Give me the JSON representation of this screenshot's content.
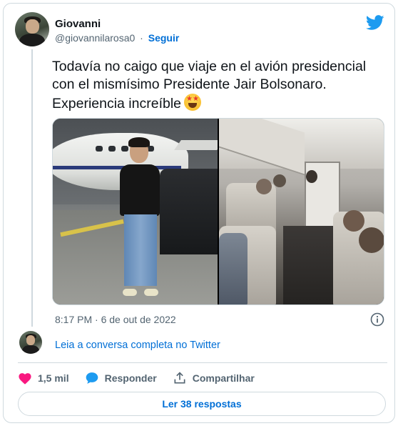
{
  "author": {
    "name": "Giovanni",
    "handle": "@giovannilarosa0",
    "separator": "·",
    "follow_label": "Seguir",
    "avatar_icon": "user-avatar"
  },
  "tweet": {
    "text": "Todavía no caigo que viaje en el avión presidencial con el mismísimo Presidente Jair Bolsonaro. Experiencia increíble",
    "emoji": "star-struck-emoji",
    "timestamp": "8:17 PM · 6 de out de 2022"
  },
  "conversation_link": "Leia a conversa completa no Twitter",
  "actions": {
    "like_count": "1,5 mil",
    "reply_label": "Responder",
    "share_label": "Compartilhar"
  },
  "replies_button": "Ler 38 respostas",
  "colors": {
    "brand_blue": "#1d9bf0",
    "link_blue": "#006fd6",
    "like_pink": "#f91880",
    "muted": "#536471",
    "border": "#cfd9de"
  },
  "icons": {
    "brand": "twitter-bird-icon",
    "info": "info-icon",
    "like": "heart-icon",
    "reply": "speech-bubble-icon",
    "share": "share-upload-icon"
  }
}
